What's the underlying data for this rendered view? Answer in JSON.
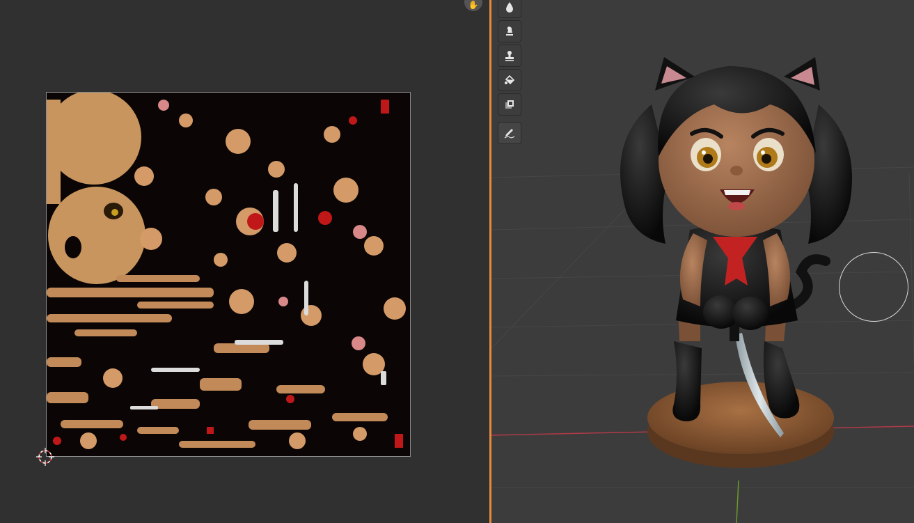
{
  "editors": {
    "left": {
      "type": "image-editor",
      "view": "uv-texture"
    },
    "right": {
      "type": "3d-viewport",
      "mode": "texture-paint"
    }
  },
  "toolbar": {
    "tools": [
      {
        "name": "draw-tool",
        "icon": "drop-icon"
      },
      {
        "name": "soften-tool",
        "icon": "smear-icon"
      },
      {
        "name": "clone-tool",
        "icon": "stamp-icon"
      },
      {
        "name": "fill-tool",
        "icon": "bucket-icon"
      },
      {
        "name": "mask-tool",
        "icon": "mask-icon"
      },
      {
        "name": "annotate-tool",
        "icon": "pencil-icon",
        "active": true
      }
    ]
  },
  "colors": {
    "divider": "#e8893d",
    "x_axis": "#b03a48",
    "y_axis": "#6a9a2a",
    "skin": "#c9955f",
    "hair": "#111111",
    "scarf": "#c22222",
    "base": "#8a5a32"
  }
}
